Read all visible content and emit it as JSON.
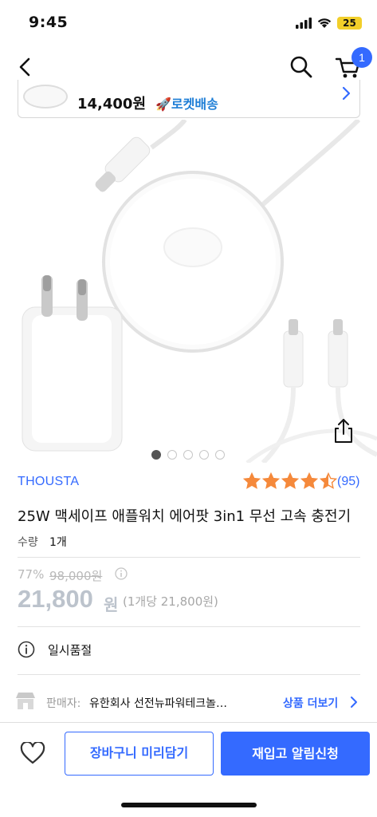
{
  "status_bar": {
    "time": "9:45",
    "battery": "25",
    "icons": [
      "signal-icon",
      "wifi-icon",
      "battery-icon"
    ]
  },
  "header": {
    "icons": [
      "back-arrow-icon",
      "search-icon",
      "cart-icon"
    ],
    "cart_count": "1"
  },
  "recommend_banner": {
    "price": "14,400원",
    "rocket_label": "🚀로켓배송"
  },
  "gallery": {
    "image_count": 5,
    "active_index": 0
  },
  "product": {
    "brand": "THOUSTA",
    "rating": 4.5,
    "review_count": "(95)",
    "title": "25W 맥세이프 애플워치 에어팟 3in1 무선 고속 충전기",
    "qty_label": "수량",
    "qty_value": "1개"
  },
  "pricing": {
    "discount": "77%",
    "original_price": "98,000원",
    "sale_price": "21,800",
    "sale_unit": "원",
    "unit_price": "(1개당 21,800원)"
  },
  "availability": {
    "status": "일시품절"
  },
  "seller": {
    "label": "판매자:",
    "name": "유한회사 선전뉴파워테크놀…",
    "more_link": "상품 더보기"
  },
  "bottom_bar": {
    "add_to_cart_label": "장바구니 미리담기",
    "notify_label": "재입고 알림신청"
  },
  "colors": {
    "accent": "#346aff",
    "star": "#f5893b",
    "rocket": "#1e7ed6",
    "disabled_price": "#bcc3cc",
    "battery": "#f2cf2a"
  }
}
